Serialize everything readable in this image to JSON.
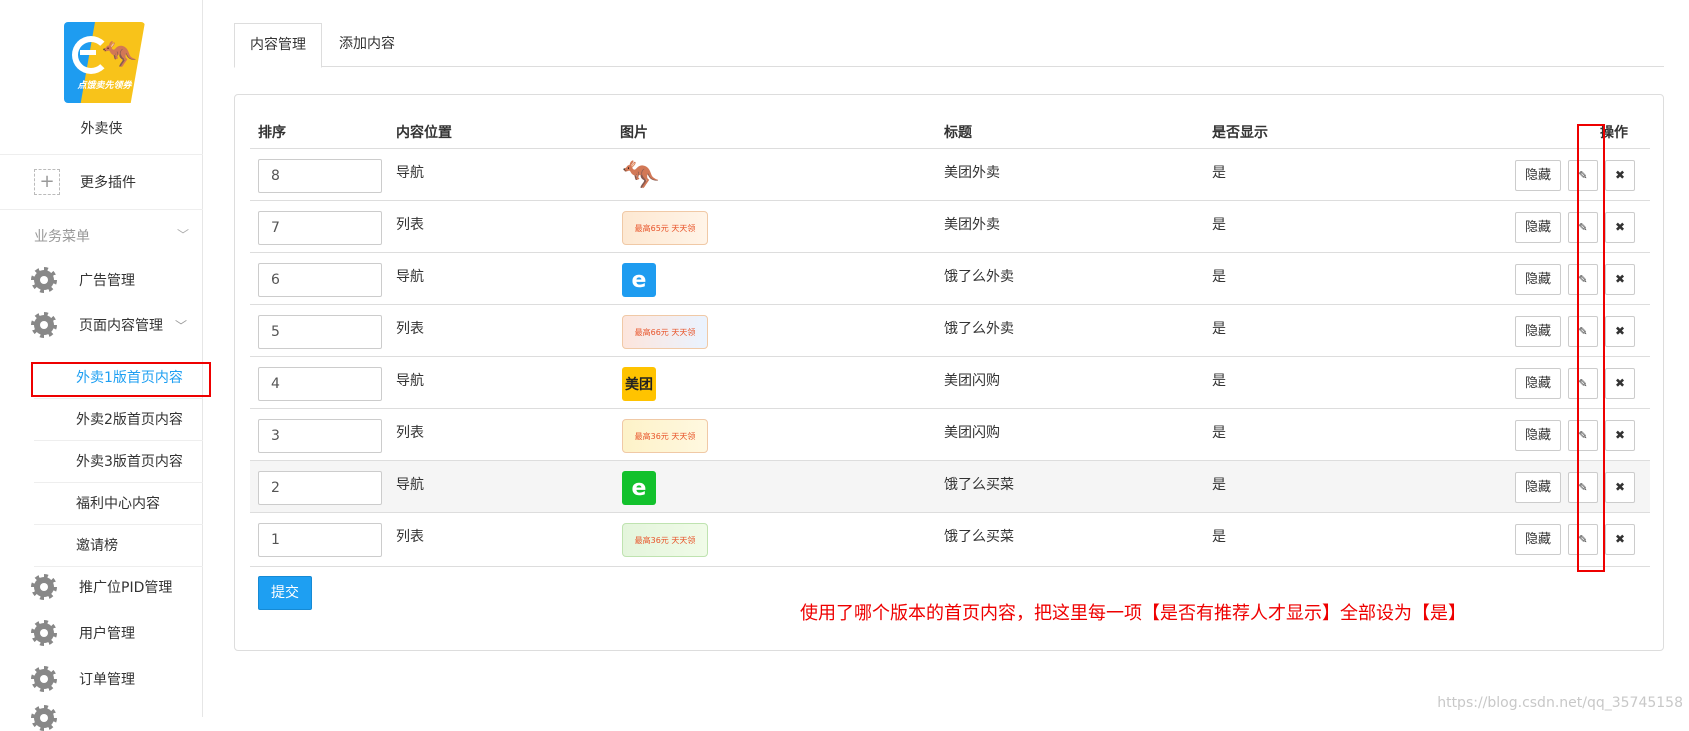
{
  "sidebar": {
    "app_name": "外卖侠",
    "logo_slogan": "点饿卖先领券",
    "more_plugins": "更多插件",
    "menu_heading": "业务菜单",
    "items": [
      {
        "label": "广告管理"
      },
      {
        "label": "页面内容管理"
      },
      {
        "label": "推广位PID管理"
      },
      {
        "label": "用户管理"
      },
      {
        "label": "订单管理"
      }
    ],
    "sub_items": [
      {
        "label": "外卖1版首页内容"
      },
      {
        "label": "外卖2版首页内容"
      },
      {
        "label": "外卖3版首页内容"
      },
      {
        "label": "福利中心内容"
      },
      {
        "label": "邀请榜"
      }
    ]
  },
  "tabs": [
    {
      "label": "内容管理"
    },
    {
      "label": "添加内容"
    }
  ],
  "table": {
    "headers": {
      "order": "排序",
      "position": "内容位置",
      "image": "图片",
      "title": "标题",
      "visible": "是否显示",
      "actions": "操作"
    },
    "rows": [
      {
        "order": "8",
        "position": "导航",
        "image": "kangaroo-icon",
        "title": "美团外卖",
        "visible": "是"
      },
      {
        "order": "7",
        "position": "列表",
        "image": "meituan-banner",
        "title": "美团外卖",
        "visible": "是",
        "banner_text": "最高65元 天天领"
      },
      {
        "order": "6",
        "position": "导航",
        "image": "eleme-icon",
        "title": "饿了么外卖",
        "visible": "是"
      },
      {
        "order": "5",
        "position": "列表",
        "image": "eleme-banner",
        "title": "饿了么外卖",
        "visible": "是",
        "banner_text": "最高66元 天天领"
      },
      {
        "order": "4",
        "position": "导航",
        "image": "meituan-logo",
        "title": "美团闪购",
        "visible": "是",
        "logo_text": "美团"
      },
      {
        "order": "3",
        "position": "列表",
        "image": "shangou-banner",
        "title": "美团闪购",
        "visible": "是",
        "banner_text": "最高36元 天天领"
      },
      {
        "order": "2",
        "position": "导航",
        "image": "eleme-green-icon",
        "title": "饿了么买菜",
        "visible": "是"
      },
      {
        "order": "1",
        "position": "列表",
        "image": "maicai-banner",
        "title": "饿了么买菜",
        "visible": "是",
        "banner_text": "最高36元 天天领"
      }
    ],
    "hide_label": "隐藏"
  },
  "submit_label": "提交",
  "annotation": "使用了哪个版本的首页内容，把这里每一项【是否有推荐人才显示】全部设为【是】",
  "watermark": "https://blog.csdn.net/qq_35745158",
  "colors": {
    "accent": "#1e9ff2",
    "annotation": "#ee0000",
    "eleme_blue": "#1e9cf0",
    "eleme_green": "#12c12c",
    "meituan_yellow": "#ffc300"
  }
}
